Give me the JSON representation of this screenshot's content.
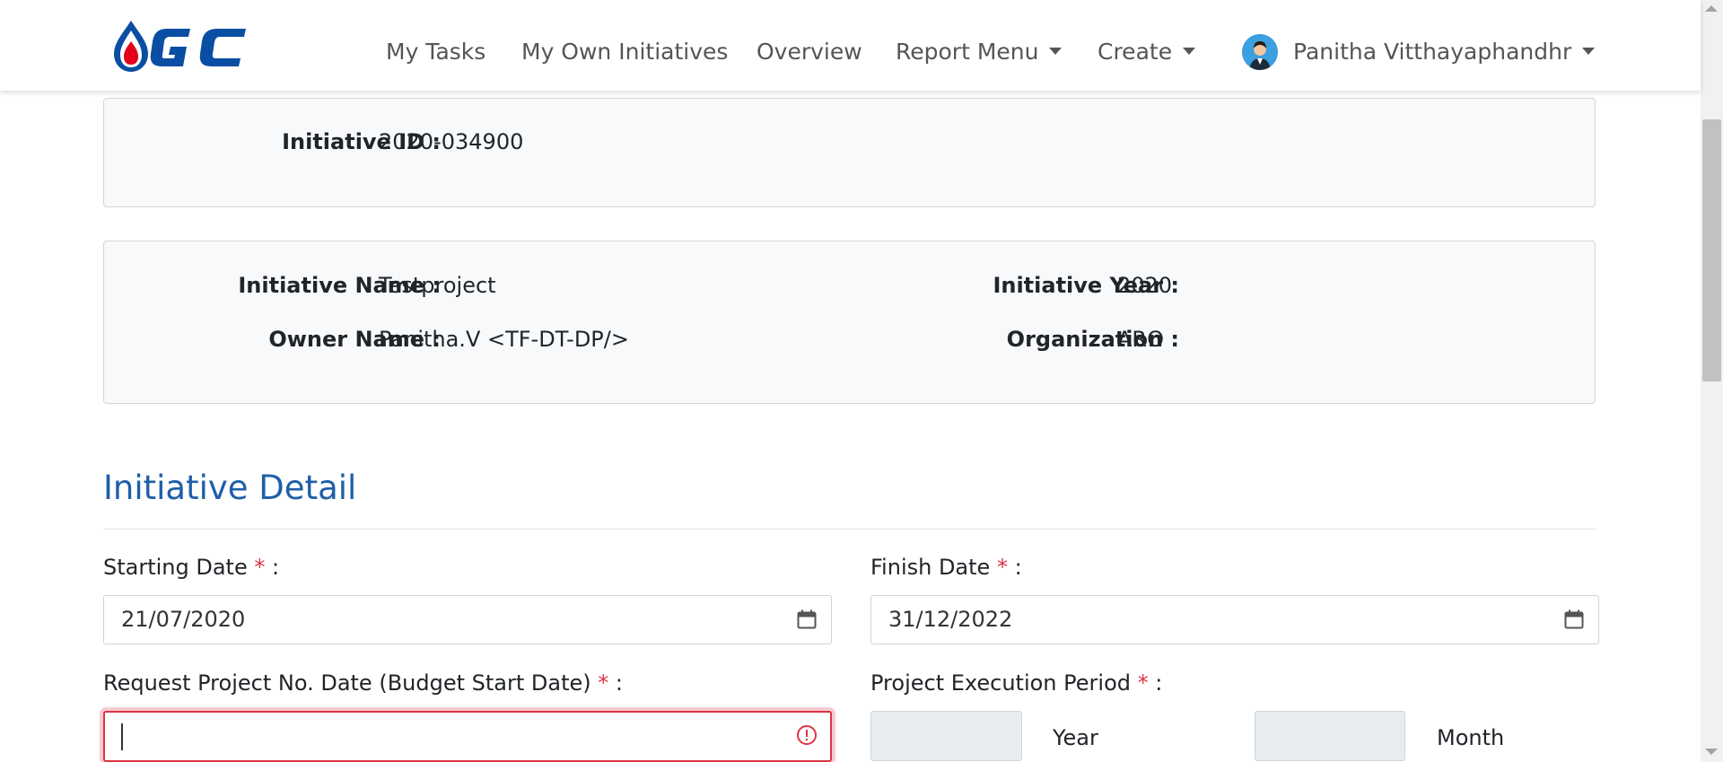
{
  "nav": {
    "items": [
      "My Tasks",
      "My Own Initiatives",
      "Overview",
      "Report Menu",
      "Create"
    ],
    "user_name": "Panitha Vitthayaphandhr"
  },
  "initiative_id_card": {
    "label": "Initiative ID :",
    "value": "2020-034900"
  },
  "info_card": {
    "name_label": "Initiative Name :",
    "name_value": "Testproject",
    "year_label": "Initiative Year :",
    "year_value": "2020",
    "owner_label": "Owner Name :",
    "owner_value": "Panitha.V <TF-DT-DP/>",
    "org_label": "Organization :",
    "org_value": "ARO"
  },
  "section": {
    "title": "Initiative Detail"
  },
  "form": {
    "required_mark": "*",
    "starting_date_label": "Starting Date",
    "starting_date_value": "21/07/2020",
    "finish_date_label": "Finish Date",
    "finish_date_value": "31/12/2022",
    "request_date_label": "Request Project No. Date (Budget Start Date)",
    "request_date_value": "",
    "execution_period_label": "Project Execution Period",
    "year_unit": "Year",
    "month_unit": "Month",
    "colon": ":"
  },
  "colors": {
    "accent": "#1e5fa8",
    "required": "#dc3545",
    "card_bg": "#f8f9fa",
    "logo_blue": "#0a4ea3",
    "logo_red": "#e3001b"
  },
  "icons": {
    "calendar": "calendar-icon",
    "error": "error-icon",
    "dropdown": "caret-down-icon"
  }
}
